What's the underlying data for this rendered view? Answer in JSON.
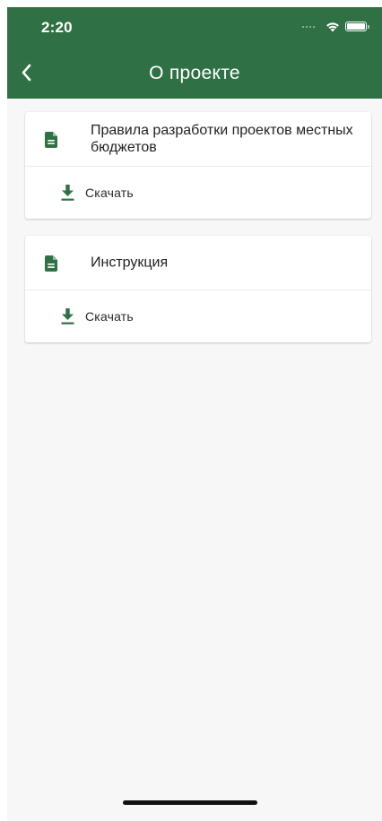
{
  "status_bar": {
    "time": "2:20"
  },
  "header": {
    "title": "О проекте",
    "back_icon": "chevron-left-icon"
  },
  "documents": [
    {
      "title": "Правила разработки проектов местных бюджетов",
      "icon": "document-icon",
      "action_label": "Скачать",
      "action_icon": "download-icon"
    },
    {
      "title": "Инструкция",
      "icon": "document-icon",
      "action_label": "Скачать",
      "action_icon": "download-icon"
    }
  ],
  "colors": {
    "primary": "#2f7144",
    "background": "#f7f7f7",
    "card": "#ffffff"
  }
}
